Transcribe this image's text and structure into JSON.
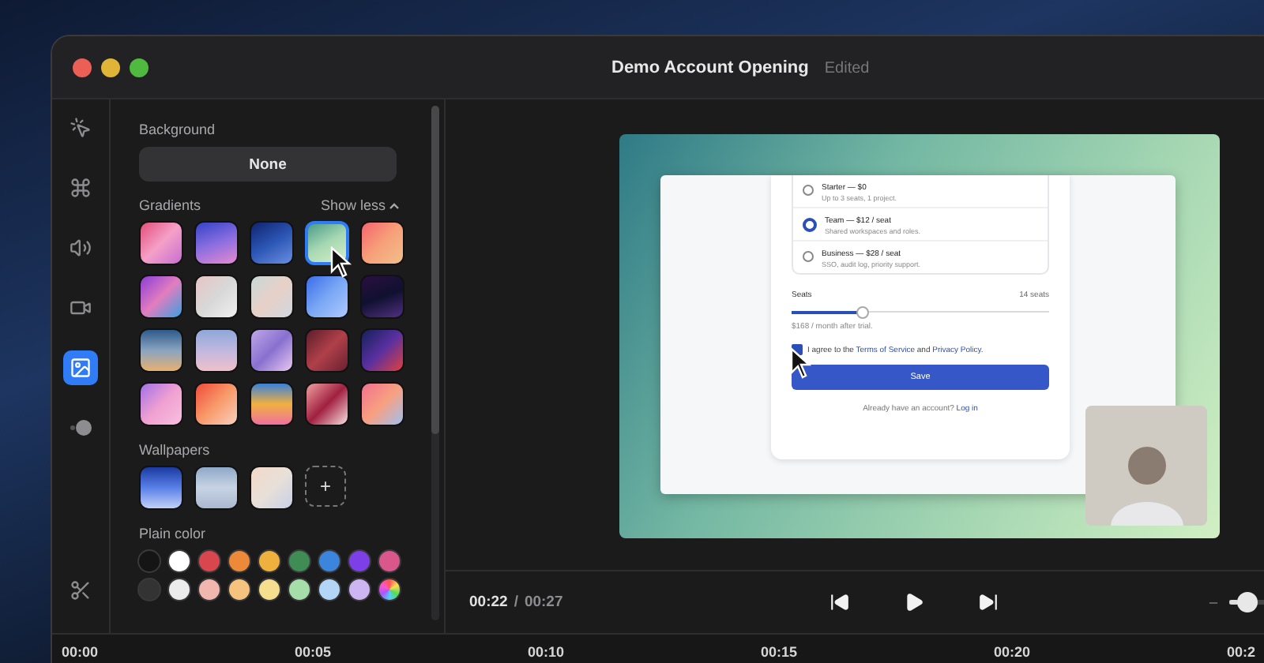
{
  "window": {
    "title": "Demo Account Opening",
    "status": "Edited"
  },
  "tool_sidebar": {
    "items": [
      {
        "kind": "cursor",
        "selected": false
      },
      {
        "kind": "keys",
        "selected": false
      },
      {
        "kind": "audio",
        "selected": false
      },
      {
        "kind": "camera",
        "selected": false
      },
      {
        "kind": "background",
        "selected": true
      },
      {
        "kind": "motion",
        "selected": false
      }
    ],
    "bottom_tool": {
      "kind": "cut"
    }
  },
  "background_panel": {
    "label": "Background",
    "none_button": "None",
    "gradients": {
      "label": "Gradients",
      "toggle": "Show less",
      "swatches": [
        {
          "selected": false
        },
        {
          "selected": false
        },
        {
          "selected": false
        },
        {
          "selected": true
        },
        {
          "selected": false
        },
        {
          "selected": false
        },
        {
          "selected": false
        },
        {
          "selected": false
        },
        {
          "selected": false
        },
        {
          "selected": false
        },
        {
          "selected": false
        },
        {
          "selected": false
        },
        {
          "selected": false
        },
        {
          "selected": false
        },
        {
          "selected": false
        },
        {
          "selected": false
        },
        {
          "selected": false
        },
        {
          "selected": false
        },
        {
          "selected": false
        },
        {
          "selected": false
        }
      ]
    },
    "wallpapers": {
      "label": "Wallpapers",
      "items": [
        {
          "selected": false
        },
        {
          "selected": false
        },
        {
          "selected": false
        }
      ],
      "add_button": "+"
    },
    "plain_color": {
      "label": "Plain color",
      "colors": [
        {
          "kind": "solid",
          "color": "#151515"
        },
        {
          "kind": "solid",
          "color": "#ffffff"
        },
        {
          "kind": "solid",
          "color": "#d9464e"
        },
        {
          "kind": "solid",
          "color": "#ec8a3a"
        },
        {
          "kind": "solid",
          "color": "#eeb13e"
        },
        {
          "kind": "solid",
          "color": "#3f8c55"
        },
        {
          "kind": "solid",
          "color": "#3b86dc"
        },
        {
          "kind": "solid",
          "color": "#7c3fe8"
        },
        {
          "kind": "solid",
          "color": "#d9578a"
        },
        {
          "kind": "solid",
          "color": "#333333"
        },
        {
          "kind": "solid",
          "color": "#ececec"
        },
        {
          "kind": "solid",
          "color": "#f1b7ae"
        },
        {
          "kind": "solid",
          "color": "#f5c37d"
        },
        {
          "kind": "solid",
          "color": "#f5de8e"
        },
        {
          "kind": "solid",
          "color": "#a6deaa"
        },
        {
          "kind": "solid",
          "color": "#b3d6f7"
        },
        {
          "kind": "solid",
          "color": "#cdb5f4"
        },
        {
          "kind": "spectrum"
        }
      ]
    }
  },
  "preview": {
    "form": {
      "plans": [
        {
          "name": "Starter — $0",
          "description": "Up to 3 seats, 1 project.",
          "selected": false
        },
        {
          "name": "Team — $12 / seat",
          "description": "Shared workspaces and roles.",
          "selected": true
        },
        {
          "name": "Business — $28 / seat",
          "description": "SSO, audit log, priority support.",
          "selected": false
        }
      ],
      "seats": {
        "label": "Seats",
        "value": "14 seats",
        "level": 0.27,
        "note": "$168 / month after trial."
      },
      "consent": {
        "checked": true,
        "parts": [
          {
            "kind": "text",
            "text": "I agree to the "
          },
          {
            "kind": "link",
            "text": "Terms of Service"
          },
          {
            "kind": "text",
            "text": " and "
          },
          {
            "kind": "link",
            "text": "Privacy Policy"
          },
          {
            "kind": "text",
            "text": "."
          }
        ]
      },
      "save_button": "Save",
      "footer": {
        "text": "Already have an account?",
        "link": "Log in"
      }
    }
  },
  "playback": {
    "current": "00:22",
    "separator": "/",
    "total": "00:27",
    "controls": [
      {
        "kind": "previous"
      },
      {
        "kind": "play"
      },
      {
        "kind": "next"
      }
    ],
    "volume": {
      "level": 0.1
    }
  },
  "timeline": {
    "ticks": [
      "00:00",
      "00:05",
      "00:10",
      "00:15",
      "00:20",
      "00:2"
    ]
  }
}
